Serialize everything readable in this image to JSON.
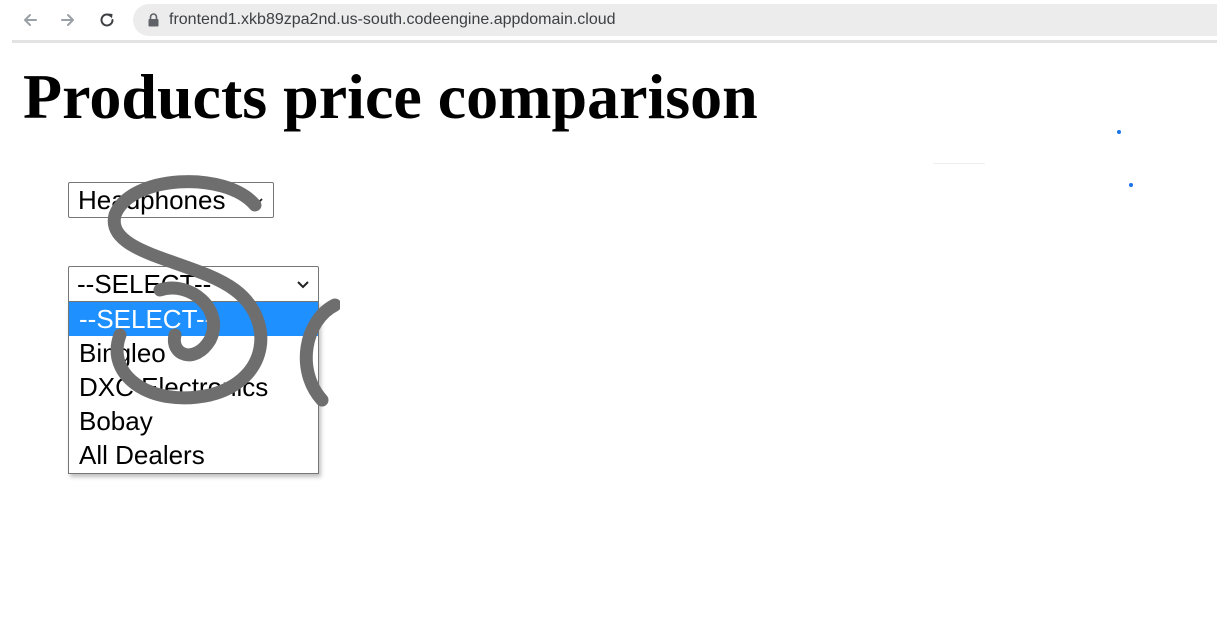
{
  "browser": {
    "url": "frontend1.xkb89zpa2nd.us-south.codeengine.appdomain.cloud",
    "icons": {
      "back": "arrow-left-icon",
      "forward": "arrow-right-icon",
      "reload": "reload-icon",
      "lock": "lock-icon"
    }
  },
  "page": {
    "title": "Products price comparison"
  },
  "category_select": {
    "value": "Headphones"
  },
  "dealer_select": {
    "value": "--SELECT--",
    "options": [
      {
        "label": "--SELECT--",
        "selected": true
      },
      {
        "label": "Bingleo",
        "selected": false
      },
      {
        "label": "DXC Electronics",
        "selected": false
      },
      {
        "label": "Bobay",
        "selected": false
      },
      {
        "label": "All Dealers",
        "selected": false
      }
    ]
  },
  "colors": {
    "highlight": "#1e90ff",
    "dot": "#1a73e8",
    "scribble": "#6e6e6e"
  }
}
